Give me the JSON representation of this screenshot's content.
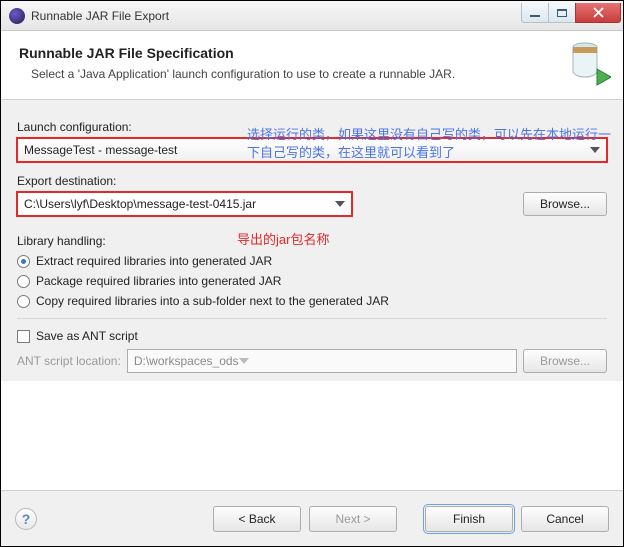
{
  "window": {
    "title": "Runnable JAR File Export"
  },
  "banner": {
    "heading": "Runnable JAR File Specification",
    "subtext": "Select a 'Java Application' launch configuration to use to create a runnable JAR."
  },
  "launch": {
    "label": "Launch configuration:",
    "value": "MessageTest - message-test"
  },
  "export": {
    "label": "Export destination:",
    "value": "C:\\Users\\lyf\\Desktop\\message-test-0415.jar",
    "browse": "Browse..."
  },
  "library": {
    "label": "Library handling:",
    "options": [
      {
        "label": "Extract required libraries into generated JAR",
        "checked": true
      },
      {
        "label": "Package required libraries into generated JAR",
        "checked": false
      },
      {
        "label": "Copy required libraries into a sub-folder next to the generated JAR",
        "checked": false
      }
    ]
  },
  "ant": {
    "checkbox_label": "Save as ANT script",
    "location_label": "ANT script location:",
    "location_value": "D:\\workspaces_ods",
    "browse": "Browse..."
  },
  "footer": {
    "back": "< Back",
    "next": "Next >",
    "finish": "Finish",
    "cancel": "Cancel"
  },
  "annotations": {
    "launch_note": "选择运行的类，如果这里没有自己写的类，可以先在本地运行一下自己写的类，在这里就可以看到了",
    "export_note": "导出的jar包名称"
  }
}
